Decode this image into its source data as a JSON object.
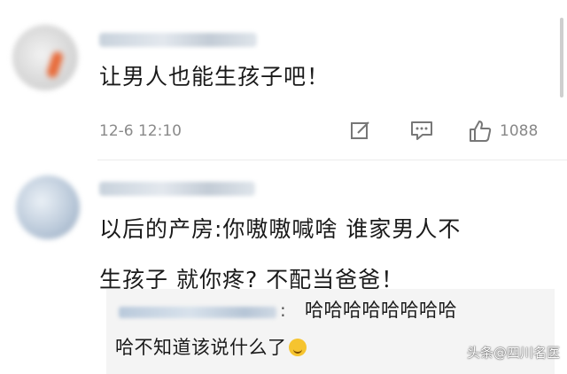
{
  "comments": [
    {
      "text": "让男人也能生孩子吧！",
      "time": "12-6 12:10",
      "likes": "1088",
      "icons": [
        "edit-icon",
        "comment-icon",
        "like-icon"
      ]
    },
    {
      "line1": "以后的产房:你嗷嗷喊啥  谁家男人不",
      "line2": "生孩子  就你疼? 不配当爸爸！",
      "reply": {
        "line1": "哈哈哈哈哈哈哈哈",
        "line2": "哈不知道该说什么了",
        "emoji": "laughing-crying-emoji"
      }
    }
  ],
  "watermark": "头条@四川名医",
  "colors": {
    "text": "#1a1a1a",
    "meta": "#8a8a8a",
    "reply_bg": "#f4f4f4",
    "emoji": "#f6c42f"
  }
}
